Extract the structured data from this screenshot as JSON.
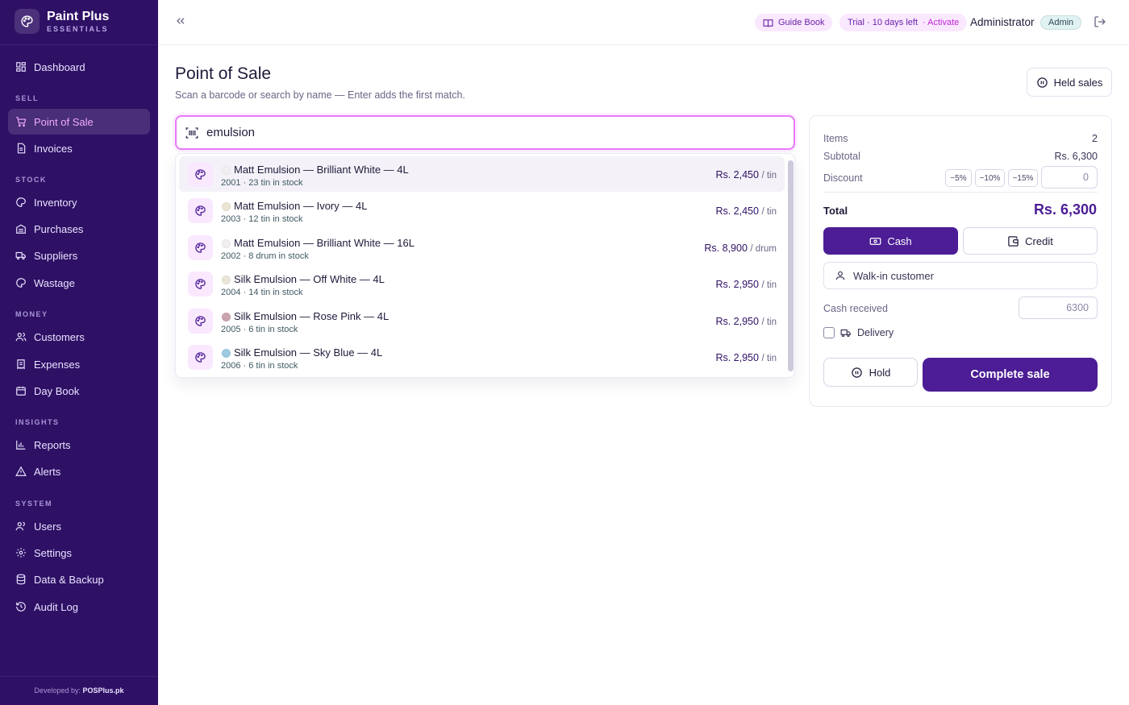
{
  "brand": {
    "name": "Paint Plus",
    "subtitle": "ESSENTIALS"
  },
  "sidebar": {
    "dashboard": "Dashboard",
    "section_sell": "SELL",
    "point_of_sale": "Point of Sale",
    "invoices": "Invoices",
    "section_stock": "STOCK",
    "inventory": "Inventory",
    "purchases": "Purchases",
    "suppliers": "Suppliers",
    "wastage": "Wastage",
    "section_money": "MONEY",
    "customers": "Customers",
    "expenses": "Expenses",
    "day_book": "Day Book",
    "section_insights": "INSIGHTS",
    "reports": "Reports",
    "alerts": "Alerts",
    "section_system": "SYSTEM",
    "users": "Users",
    "settings": "Settings",
    "data_backup": "Data & Backup",
    "audit_log": "Audit Log",
    "footer_prefix": "Developed by:",
    "footer_brand": "POSPlus.pk"
  },
  "topbar": {
    "guide_book": "Guide Book",
    "trial": "Trial · 10 days left",
    "activate": "· Activate",
    "user_name": "Administrator",
    "role_badge": "Admin"
  },
  "page": {
    "title": "Point of Sale",
    "subtitle": "Scan a barcode or search by name — Enter adds the first match.",
    "held_sales": "Held sales"
  },
  "search": {
    "value": "emulsion"
  },
  "results": [
    {
      "name": "Matt Emulsion — Brilliant White — 4L",
      "meta": "2001 · 23 tin in stock",
      "price": "Rs. 2,450",
      "unit": "/ tin",
      "swatch": "#f1efef"
    },
    {
      "name": "Matt Emulsion — Ivory — 4L",
      "meta": "2003 · 12 tin in stock",
      "price": "Rs. 2,450",
      "unit": "/ tin",
      "swatch": "#ece4d3"
    },
    {
      "name": "Matt Emulsion — Brilliant White — 16L",
      "meta": "2002 · 8 drum in stock",
      "price": "Rs. 8,900",
      "unit": "/ drum",
      "swatch": "#f1efef"
    },
    {
      "name": "Silk Emulsion — Off White — 4L",
      "meta": "2004 · 14 tin in stock",
      "price": "Rs. 2,950",
      "unit": "/ tin",
      "swatch": "#ebe5d8"
    },
    {
      "name": "Silk Emulsion — Rose Pink — 4L",
      "meta": "2005 · 6 tin in stock",
      "price": "Rs. 2,950",
      "unit": "/ tin",
      "swatch": "#c9a4ae"
    },
    {
      "name": "Silk Emulsion — Sky Blue — 4L",
      "meta": "2006 · 6 tin in stock",
      "price": "Rs. 2,950",
      "unit": "/ tin",
      "swatch": "#9ccbe0"
    }
  ],
  "cart": {
    "items_label": "Items",
    "items_value": "2",
    "subtotal_label": "Subtotal",
    "subtotal_value": "Rs. 6,300",
    "discount_label": "Discount",
    "discount_5": "−5%",
    "discount_10": "−10%",
    "discount_15": "−15%",
    "discount_value": "0",
    "total_label": "Total",
    "total_value": "Rs. 6,300",
    "cash": "Cash",
    "credit": "Credit",
    "customer": "Walk-in customer",
    "cash_received_label": "Cash received",
    "cash_received_value": "6300",
    "delivery": "Delivery",
    "hold": "Hold",
    "complete": "Complete sale"
  },
  "colors": {
    "sidebar": "#2e1065",
    "accent": "#4c1d95",
    "highlight": "#e879f9"
  }
}
